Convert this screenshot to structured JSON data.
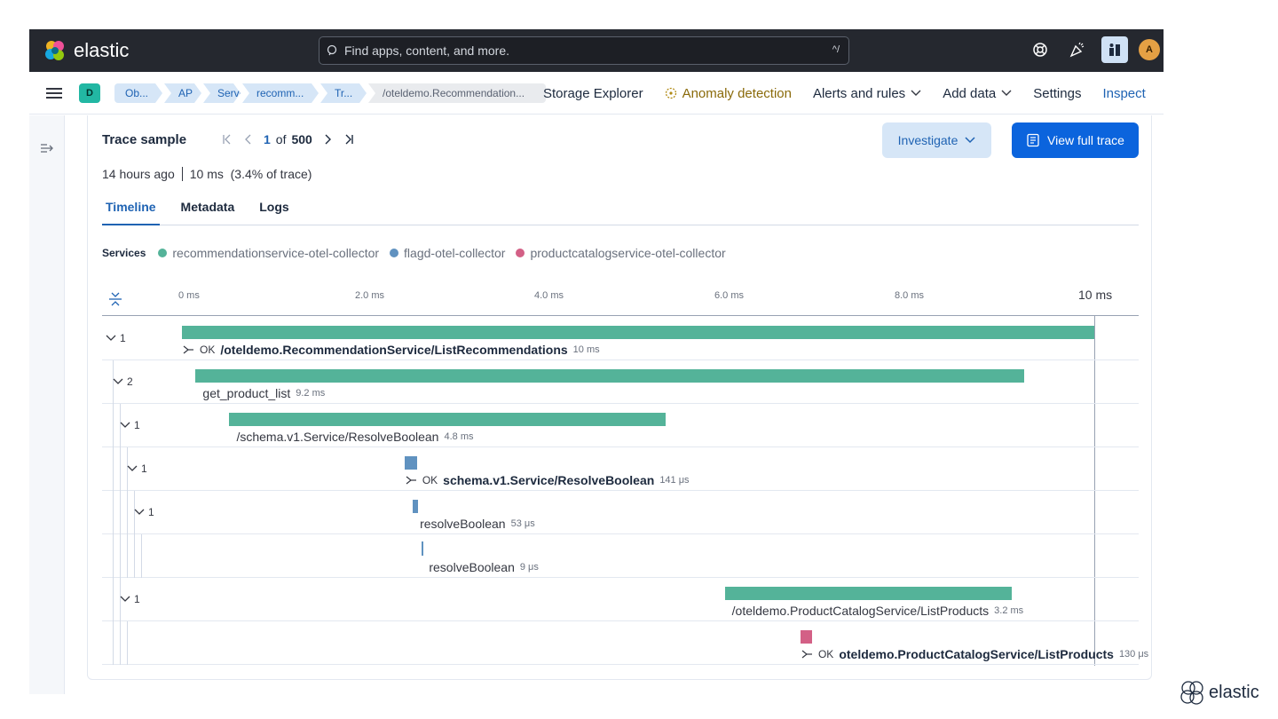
{
  "header": {
    "logo_text": "elastic",
    "search_placeholder": "Find apps, content, and more.",
    "search_shortcut": "^/",
    "avatar_initial": "A"
  },
  "nav": {
    "space_badge": "D",
    "breadcrumbs": [
      "Ob...",
      "AP",
      "Servi",
      "recomm...",
      "Tr...",
      "/oteldemo.Recommendation..."
    ],
    "links": {
      "storage_explorer": "Storage Explorer",
      "anomaly_detection": "Anomaly detection",
      "alerts_and_rules": "Alerts and rules",
      "add_data": "Add data",
      "settings": "Settings",
      "inspect": "Inspect"
    }
  },
  "trace": {
    "title": "Trace sample",
    "pager": {
      "current": "1",
      "of": "of",
      "total": "500"
    },
    "investigate_label": "Investigate",
    "view_full_trace_label": "View full trace",
    "age": "14 hours ago",
    "duration_summary": "10 ms  (3.4% of trace)",
    "tabs": [
      "Timeline",
      "Metadata",
      "Logs"
    ],
    "active_tab": "Timeline",
    "services_label": "Services",
    "services": [
      {
        "name": "recommendationservice-otel-collector",
        "color": "#54b399"
      },
      {
        "name": "flagd-otel-collector",
        "color": "#6092c0"
      },
      {
        "name": "productcatalogservice-otel-collector",
        "color": "#d36086"
      }
    ]
  },
  "timeline": {
    "axis_ticks": [
      "0 ms",
      "2.0 ms",
      "4.0 ms",
      "6.0 ms",
      "8.0 ms",
      "10 ms"
    ],
    "total_ms": 10,
    "spans": [
      {
        "toggle": "1",
        "depth": 0,
        "start_ms": 0,
        "dur_ms": 10,
        "color": "#54b399",
        "status": "OK",
        "name": "/oteldemo.RecommendationService/ListRecommendations",
        "bold": true,
        "dur_label": "10 ms",
        "has_icon": true
      },
      {
        "toggle": "2",
        "depth": 1,
        "start_ms": 0.15,
        "dur_ms": 9.08,
        "color": "#54b399",
        "status": "",
        "name": "get_product_list",
        "bold": false,
        "dur_label": "9.2 ms",
        "has_icon": false
      },
      {
        "toggle": "1",
        "depth": 2,
        "start_ms": 0.52,
        "dur_ms": 4.78,
        "color": "#54b399",
        "status": "",
        "name": "/schema.v1.Service/ResolveBoolean",
        "bold": false,
        "dur_label": "4.8 ms",
        "has_icon": false
      },
      {
        "toggle": "1",
        "depth": 3,
        "start_ms": 2.44,
        "dur_ms": 0.141,
        "color": "#6092c0",
        "status": "OK",
        "name": "schema.v1.Service/ResolveBoolean",
        "bold": true,
        "dur_label": "141 μs",
        "has_icon": true
      },
      {
        "toggle": "1",
        "depth": 4,
        "start_ms": 2.53,
        "dur_ms": 0.053,
        "color": "#6092c0",
        "status": "",
        "name": "resolveBoolean",
        "bold": false,
        "dur_label": "53 μs",
        "has_icon": false
      },
      {
        "toggle": "",
        "depth": 5,
        "start_ms": 2.63,
        "dur_ms": 0.009,
        "color": "#6092c0",
        "status": "",
        "name": "resolveBoolean",
        "bold": false,
        "dur_label": "9 μs",
        "has_icon": false
      },
      {
        "toggle": "1",
        "depth": 2,
        "start_ms": 5.95,
        "dur_ms": 3.15,
        "color": "#54b399",
        "status": "",
        "name": "/oteldemo.ProductCatalogService/ListProducts",
        "bold": false,
        "dur_label": "3.2 ms",
        "has_icon": false
      },
      {
        "toggle": "",
        "depth": 3,
        "start_ms": 6.78,
        "dur_ms": 0.13,
        "color": "#d36086",
        "status": "OK",
        "name": "oteldemo.ProductCatalogService/ListProducts",
        "bold": true,
        "dur_label": "130 μs",
        "has_icon": true
      }
    ]
  },
  "footer_brand": "elastic"
}
